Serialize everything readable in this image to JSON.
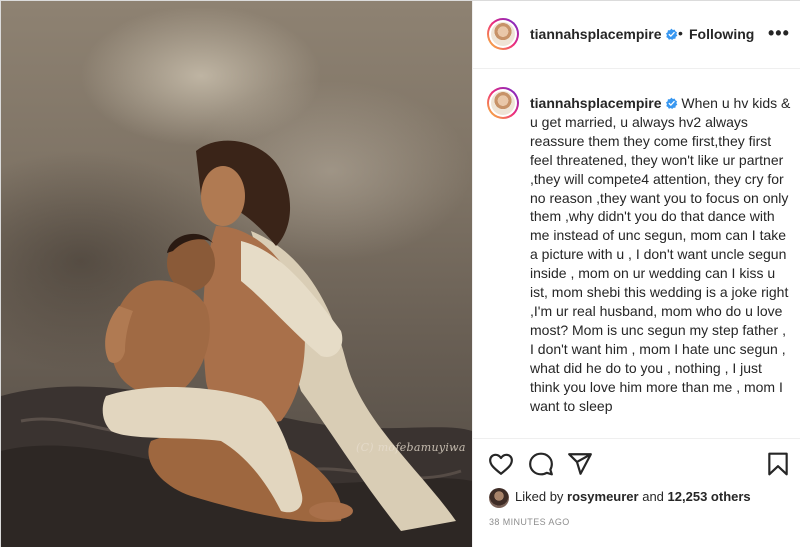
{
  "post": {
    "watermark": "(C) mofebamuyiwa"
  },
  "header": {
    "username": "tiannahsplacempire",
    "verified": true,
    "separator": "•",
    "follow_label": "Following",
    "more_label": "•••"
  },
  "caption": {
    "username": "tiannahsplacempire",
    "text": "When u hv kids & u get married, u always hv2 always reassure them they come first,they first feel threatened, they won't like ur partner ,they will compete4 attention, they cry for no reason ,they want you to focus on only them ,why didn't you do that dance with me instead of unc segun, mom can I take a picture with u , I don't want uncle segun inside , mom on ur wedding can I kiss u ist, mom shebi this wedding is a joke right ,I'm ur real husband, mom who do u love most? Mom is unc segun my step father , I don't want him , mom I hate unc segun , what did he do to you , nothing , I just think you love him more than me , mom I want to sleep"
  },
  "actions": {
    "icons": [
      "heart-icon",
      "comment-icon",
      "share-icon",
      "bookmark-icon"
    ]
  },
  "likes": {
    "prefix": "Liked by",
    "user": "rosymeurer",
    "conjunction": "and",
    "count": "12,253 others"
  },
  "timestamp": "38 MINUTES AGO",
  "colors": {
    "verified": "#3897f0",
    "text": "#262626",
    "muted": "#8e8e8e",
    "divider": "#efefef"
  }
}
